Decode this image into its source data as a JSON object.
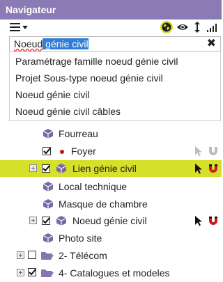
{
  "window": {
    "title": "Navigateur"
  },
  "colors": {
    "titlebar": "#8a7bb4",
    "highlight": "#d4e02a",
    "selection": "#2f7dd6",
    "cube": "#7b66a6",
    "folder": "#8a74b0",
    "magnet": "#c81e1e"
  },
  "toolbar": {
    "icons": [
      "menu-icon",
      "globe-icon",
      "eye-icon",
      "vertical-resize-icon",
      "signal-icon"
    ]
  },
  "search": {
    "typed": "Noeud",
    "selected": " génie civil",
    "clear_icon": "close-icon"
  },
  "suggestions": [
    "Paramétrage famille noeud génie civil",
    "Projet Sous-type noeud génie civil",
    "Noeud génie civil",
    "Noeud génie civil câbles"
  ],
  "tree": {
    "fourreau": "Fourreau",
    "foyer": "Foyer",
    "lien_gc": "Lien génie civil",
    "local_technique": "Local technique",
    "masque": "Masque de chambre",
    "noeud_gc": "Noeud génie civil",
    "photo_site": "Photo site",
    "telecom": "2- Télécom",
    "catalogues": "4- Catalogues et modeles"
  }
}
